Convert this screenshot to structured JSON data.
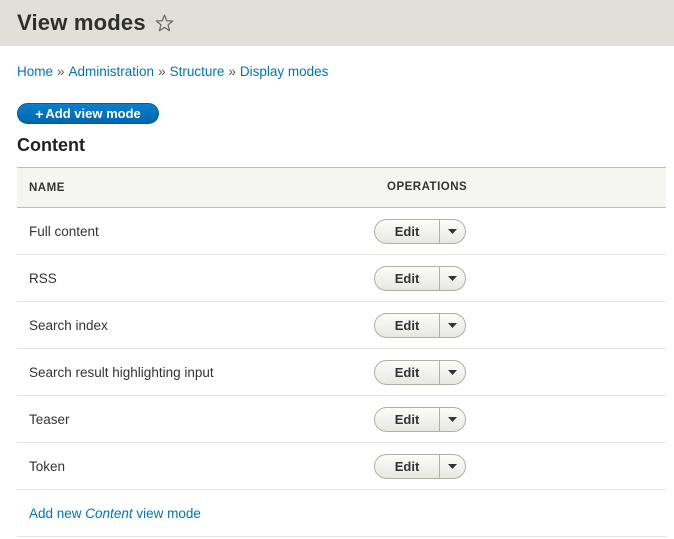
{
  "header": {
    "title": "View modes"
  },
  "breadcrumb": [
    "Home",
    "Administration",
    "Structure",
    "Display modes"
  ],
  "breadcrumb_separator": "»",
  "add_button": {
    "plus": "+",
    "label": "Add view mode"
  },
  "section": {
    "title": "Content"
  },
  "table": {
    "headers": {
      "name": "NAME",
      "operations": "OPERATIONS"
    },
    "rows": [
      {
        "name": "Full content",
        "action": "Edit"
      },
      {
        "name": "RSS",
        "action": "Edit"
      },
      {
        "name": "Search index",
        "action": "Edit"
      },
      {
        "name": "Search result highlighting input",
        "action": "Edit"
      },
      {
        "name": "Teaser",
        "action": "Edit"
      },
      {
        "name": "Token",
        "action": "Edit"
      }
    ]
  },
  "add_link": {
    "prefix": "Add new ",
    "entity": "Content",
    "suffix": " view mode"
  },
  "colors": {
    "link": "#0074bd",
    "header_bg": "#e0e0d8",
    "button_primary": "#0074bd"
  }
}
